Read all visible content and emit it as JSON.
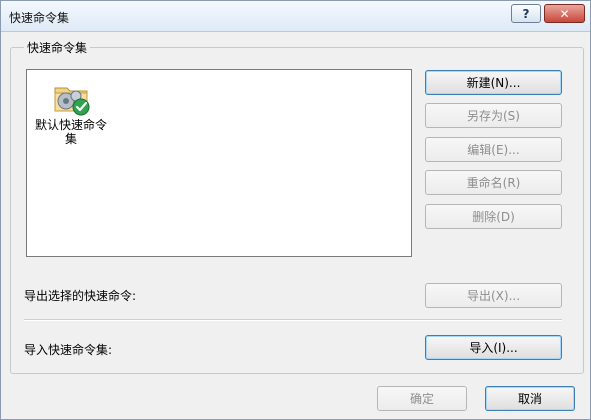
{
  "window": {
    "title": "快速命令集",
    "help_label": "?",
    "close_label": "✕"
  },
  "group": {
    "title": "快速命令集"
  },
  "list": {
    "items": [
      {
        "label": "默认快速命令集",
        "icon": "folder-settings-check-icon"
      }
    ]
  },
  "buttons": {
    "new": "新建(N)...",
    "save_as": "另存为(S)",
    "edit": "编辑(E)...",
    "rename": "重命名(R)",
    "delete": "删除(D)",
    "export": "导出(X)...",
    "import": "导入(I)...",
    "ok": "确定",
    "cancel": "取消"
  },
  "labels": {
    "export_selected": "导出选择的快速命令:",
    "import_set": "导入快速命令集:"
  },
  "colors": {
    "accent": "#3c7fb1",
    "close": "#c9473a"
  }
}
